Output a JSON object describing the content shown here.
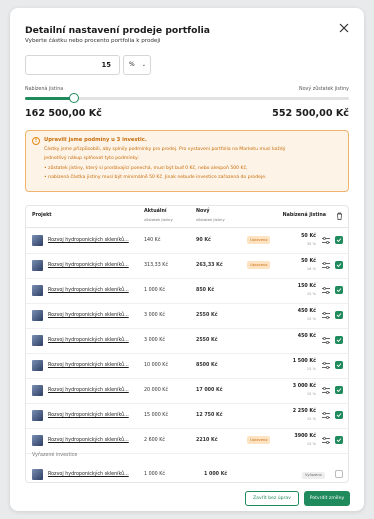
{
  "modal": {
    "title": "Detailní nastavení prodeje portfolia",
    "subtitle": "Vyberte částku nebo procento portfolia k prodeji",
    "percent_value": "15",
    "unit_select": "%",
    "slider_left_label": "Nabízená jistina",
    "slider_right_label": "Nový zůstatek jistiny",
    "slider_fraction": 0.15,
    "amount_left": "162 500,00 Kč",
    "amount_right": "552 500,00 Kč"
  },
  "warning": {
    "title": "Upravili jsme podmíny u 3 investic.",
    "lines": [
      "Částky jsme přizpůsobili, aby splnily podmínky pro prodej. Pro vystavení portfolia na Marketu musí každý",
      "jednotlivý nákup splňovat tyto podmínky:",
      "• zůstatek jistiny, který si prodávající ponechá, musí být buď 0 Kč, nebo alespoň 500 Kč,",
      "• nabízená částka jistiny musí být minimálně 50 Kč. Jinak nebude investice zařazená do prodeje."
    ]
  },
  "table": {
    "headers": {
      "project": "Projekt",
      "current": "Aktuální",
      "current_sub": "zůstatek jistiny",
      "new": "Nový",
      "new_sub": "zůstatek jistiny",
      "offered": "Nabízená jistina"
    },
    "rows": [
      {
        "project": "Rozvoj hydroponických skleníků...",
        "current": "140 Kč",
        "new": "90 Kč",
        "badge": "Upraveno",
        "offered": "50 Kč",
        "offered_pct": "35 %"
      },
      {
        "project": "Rozvoj hydroponických skleníků...",
        "current": "313,33 Kč",
        "new": "263,33 Kč",
        "badge": "Upraveno",
        "offered": "50 Kč",
        "offered_pct": "16 %"
      },
      {
        "project": "Rozvoj hydroponických skleníků...",
        "current": "1 000 Kč",
        "new": "850 Kč",
        "badge": "",
        "offered": "150 Kč",
        "offered_pct": "15 %"
      },
      {
        "project": "Rozvoj hydroponických skleníků...",
        "current": "3 000 Kč",
        "new": "2550 Kč",
        "badge": "",
        "offered": "450 Kč",
        "offered_pct": "15 %"
      },
      {
        "project": "Rozvoj hydroponických skleníků...",
        "current": "3 000 Kč",
        "new": "2550 Kč",
        "badge": "",
        "offered": "450 Kč",
        "offered_pct": ""
      },
      {
        "project": "Rozvoj hydroponických skleníků...",
        "current": "10 000 Kč",
        "new": "8500 Kč",
        "badge": "",
        "offered": "1 500 Kč",
        "offered_pct": "15 %"
      },
      {
        "project": "Rozvoj hydroponických skleníků...",
        "current": "20 000 Kč",
        "new": "17 000 Kč",
        "badge": "",
        "offered": "3 000 Kč",
        "offered_pct": "15 %"
      },
      {
        "project": "Rozvoj hydroponických skleníků...",
        "current": "15 000 Kč",
        "new": "12 750 Kč",
        "badge": "",
        "offered": "2 250 Kč",
        "offered_pct": "15 %"
      },
      {
        "project": "Rozvoj hydroponických skleníků...",
        "current": "2 600 Kč",
        "new": "2210 Kč",
        "badge": "Upraveno",
        "offered": "3900 Kč",
        "offered_pct": "15 %"
      }
    ],
    "excluded_section": "Vyřazené investice",
    "excluded_row": {
      "project": "Rozvoj hydroponických skleníků...",
      "current": "1 000 Kč",
      "new": "1 000 Kč",
      "badge": "Vyřazeno"
    }
  },
  "footer": {
    "secondary_button": "Zavřít bez úprav",
    "primary_button": "Potvrdit změny"
  },
  "colors": {
    "accent": "#1f8a5b",
    "warning": "#c76d0c",
    "warning_bg": "#fdf3e6"
  }
}
